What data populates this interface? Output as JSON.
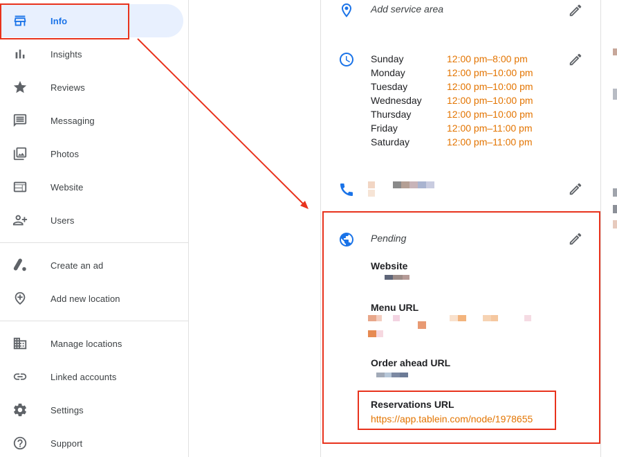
{
  "sidebar": {
    "items": [
      {
        "label": "Info",
        "icon": "storefront-icon",
        "active": true
      },
      {
        "label": "Insights",
        "icon": "bar-chart-icon"
      },
      {
        "label": "Reviews",
        "icon": "star-icon"
      },
      {
        "label": "Messaging",
        "icon": "message-icon"
      },
      {
        "label": "Photos",
        "icon": "photos-icon"
      },
      {
        "label": "Website",
        "icon": "website-icon"
      },
      {
        "label": "Users",
        "icon": "add-user-icon"
      }
    ],
    "items2": [
      {
        "label": "Create an ad",
        "icon": "google-ads-icon"
      },
      {
        "label": "Add new location",
        "icon": "add-location-icon"
      }
    ],
    "items3": [
      {
        "label": "Manage locations",
        "icon": "building-icon"
      },
      {
        "label": "Linked accounts",
        "icon": "link-icon"
      },
      {
        "label": "Settings",
        "icon": "gear-icon"
      },
      {
        "label": "Support",
        "icon": "help-icon"
      }
    ]
  },
  "info": {
    "service_area": "Add service area",
    "hours": [
      {
        "day": "Sunday",
        "time": "12:00 pm–8:00 pm"
      },
      {
        "day": "Monday",
        "time": "12:00 pm–10:00 pm"
      },
      {
        "day": "Tuesday",
        "time": "12:00 pm–10:00 pm"
      },
      {
        "day": "Wednesday",
        "time": "12:00 pm–10:00 pm"
      },
      {
        "day": "Thursday",
        "time": "12:00 pm–10:00 pm"
      },
      {
        "day": "Friday",
        "time": "12:00 pm–11:00 pm"
      },
      {
        "day": "Saturday",
        "time": "12:00 pm–11:00 pm"
      }
    ],
    "website_status": "Pending",
    "website_label": "Website",
    "menu_label": "Menu URL",
    "order_label": "Order ahead URL",
    "reservations_label": "Reservations URL",
    "reservations_url": "https://app.tablein.com/node/1978655"
  },
  "colors": {
    "accent": "#1a73e8",
    "highlight": "#e8321c",
    "time_text": "#e37400"
  }
}
